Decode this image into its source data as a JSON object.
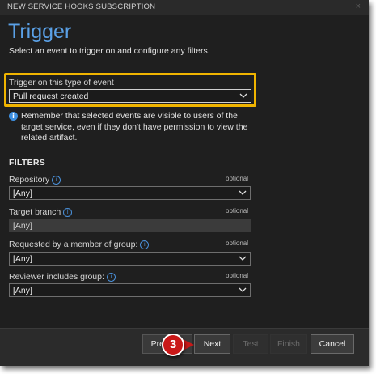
{
  "dialog": {
    "title": "NEW SERVICE HOOKS SUBSCRIPTION",
    "close_glyph": "×"
  },
  "heading": "Trigger",
  "subtitle": "Select an event to trigger on and configure any filters.",
  "trigger": {
    "label": "Trigger on this type of event",
    "value": "Pull request created"
  },
  "note": "Remember that selected events are visible to users of the target service, even if they don't have permission to view the related artifact.",
  "filters": {
    "title": "FILTERS",
    "repository": {
      "label": "Repository",
      "optional": "optional",
      "value": "[Any]"
    },
    "target_branch": {
      "label": "Target branch",
      "optional": "optional",
      "value": "[Any]"
    },
    "requested_by": {
      "label": "Requested by a member of group:",
      "optional": "optional",
      "value": "[Any]"
    },
    "reviewer": {
      "label": "Reviewer includes group:",
      "optional": "optional",
      "value": "[Any]"
    }
  },
  "footer": {
    "previous_label": "Previous",
    "next_label": "Next",
    "test_label": "Test",
    "finish_label": "Finish",
    "cancel_label": "Cancel"
  },
  "callout": {
    "number": "3"
  },
  "colors": {
    "accent": "#5aa0e6",
    "highlight": "#f0b400",
    "callout": "#c91818"
  }
}
